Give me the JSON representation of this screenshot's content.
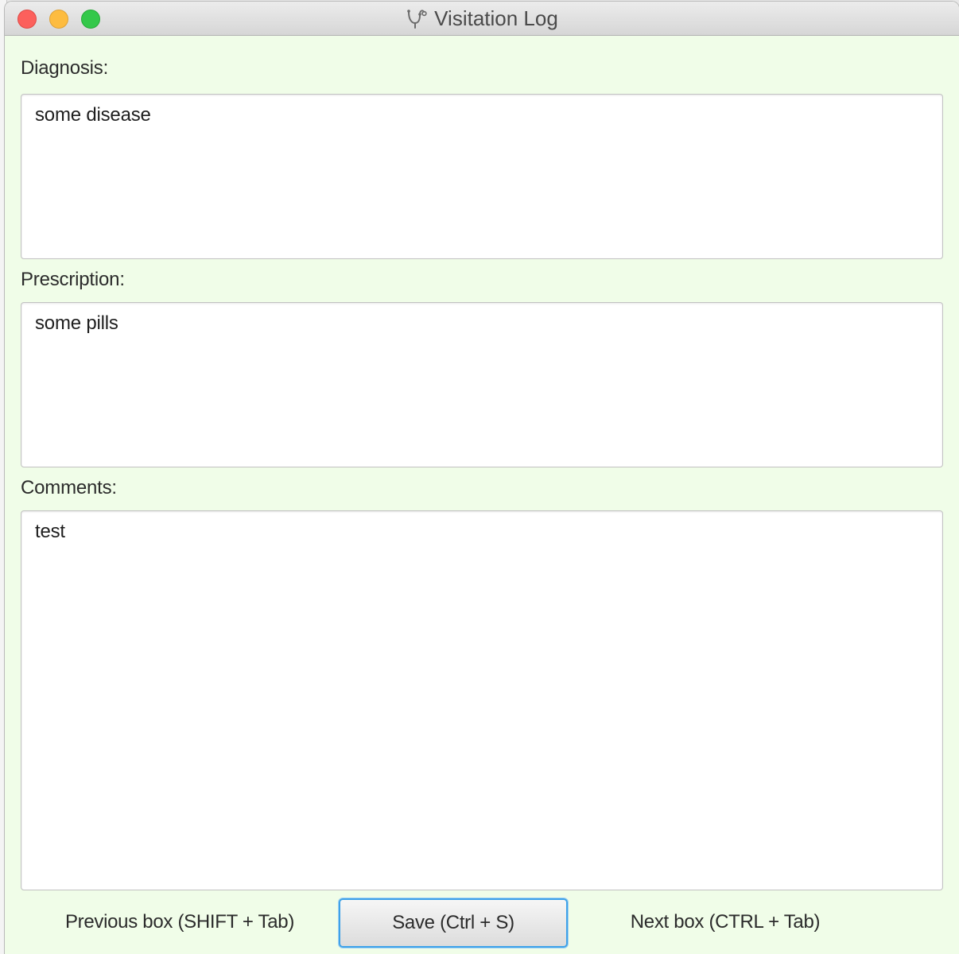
{
  "window": {
    "title": "Visitation Log",
    "title_icon": "stethoscope-icon"
  },
  "form": {
    "diagnosis": {
      "label": "Diagnosis:",
      "value": "some disease"
    },
    "prescription": {
      "label": "Prescription:",
      "value": "some pills"
    },
    "comments": {
      "label": "Comments:",
      "value": "test"
    }
  },
  "actions": {
    "previous_label": "Previous box (SHIFT + Tab)",
    "save_label": "Save (Ctrl + S)",
    "next_label": "Next box (CTRL + Tab)"
  },
  "colors": {
    "window_background": "#f0fde8",
    "focus_accent": "#3ea2e8",
    "close": "#fc605c",
    "minimize": "#fdbc40",
    "zoom": "#34c84a"
  }
}
